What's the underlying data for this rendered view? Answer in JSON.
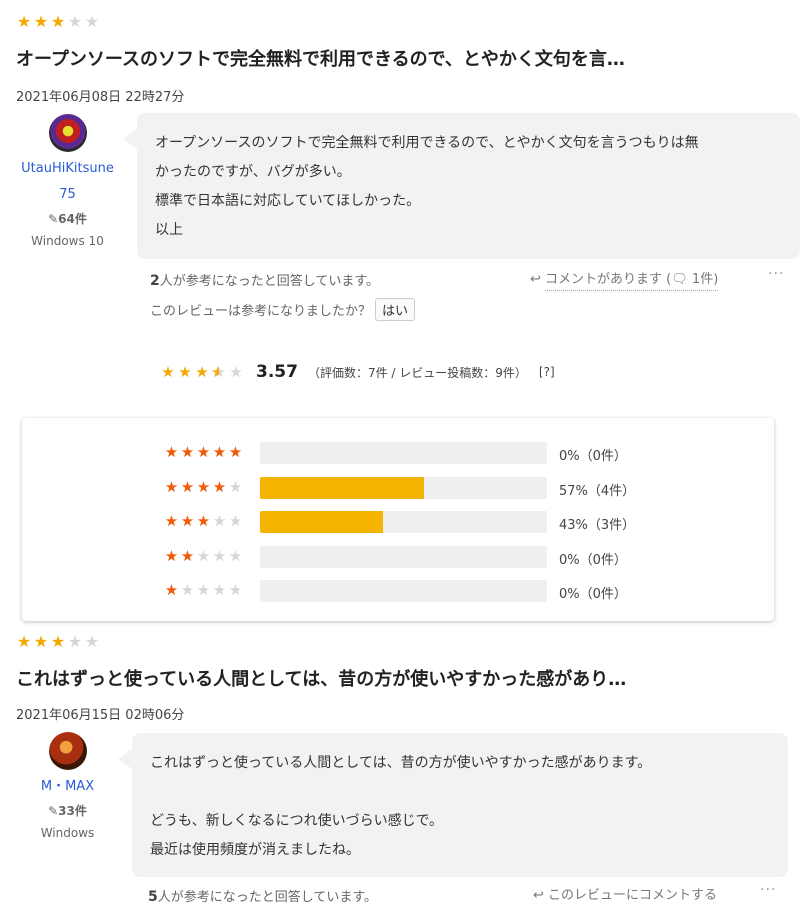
{
  "review1": {
    "rating": 3,
    "title": "オープンソースのソフトで完全無料で利用できるので、とやかく文句を言…",
    "date": "2021年06月08日 22時27分",
    "user": {
      "name": "UtauHiKitsune",
      "name2": "75",
      "count_icon": "edit-icon",
      "count": "64件",
      "os": "Windows 10"
    },
    "body": [
      "オープンソースのソフトで完全無料で利用できるので、とやかく文句を言うつもりは無",
      "かったのですが、バグが多い。",
      "標準で日本語に対応していてほしかった。",
      "以上"
    ],
    "helpful_count": "2",
    "helpful_text": "人が参考になったと回答しています。",
    "comment_link": "コメントがあります (",
    "comment_icon_name": "comment-icon",
    "comment_count": "1件)",
    "question": "このレビューは参考になりましたか？",
    "yes_label": "はい",
    "more": "···"
  },
  "summary": {
    "rating": 3.57,
    "score": "3.57",
    "meta": "（評価数：7件 / レビュー投稿数：9件）",
    "help": "[?]"
  },
  "distribution": [
    {
      "stars": 5,
      "percent": 0,
      "label": "0%（0件）"
    },
    {
      "stars": 4,
      "percent": 57,
      "label": "57%（4件）"
    },
    {
      "stars": 3,
      "percent": 43,
      "label": "43%（3件）"
    },
    {
      "stars": 2,
      "percent": 0,
      "label": "0%（0件）"
    },
    {
      "stars": 1,
      "percent": 0,
      "label": "0%（0件）"
    }
  ],
  "review2": {
    "rating": 3,
    "title": "これはずっと使っている人間としては、昔の方が使いやすかった感があり…",
    "date": "2021年06月15日 02時06分",
    "user": {
      "name": "M・MAX",
      "count_icon": "edit-icon",
      "count": "33件",
      "os": "Windows"
    },
    "body": [
      "これはずっと使っている人間としては、昔の方が使いやすかった感があります。",
      "",
      "どうも、新しくなるにつれ使いづらい感じで。",
      "最近は使用頻度が消えましたね。"
    ],
    "helpful_count": "5",
    "helpful_text": "人が参考になったと回答しています。",
    "comment_link": "このレビューにコメントする",
    "more": "···"
  }
}
